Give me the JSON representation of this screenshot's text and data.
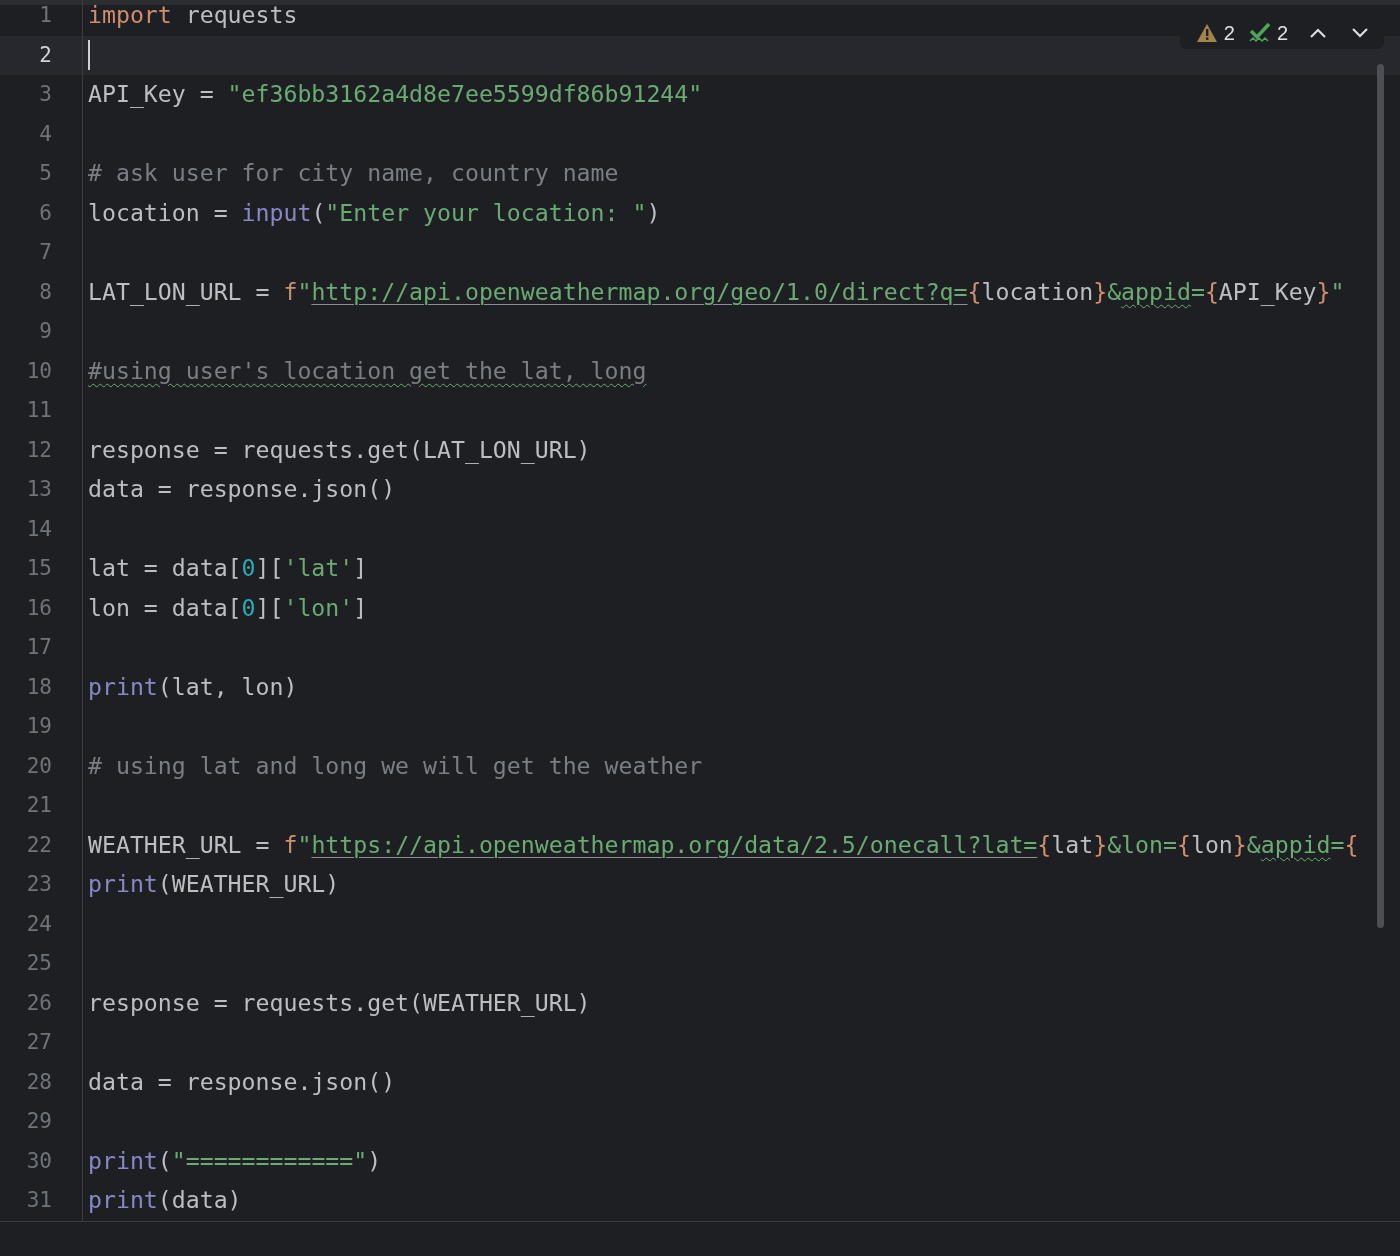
{
  "inspections": {
    "warnings": "2",
    "checks": "2"
  },
  "lines": [
    {
      "number": "1",
      "current": false,
      "tokens": [
        {
          "kind": "keyword",
          "text": "import"
        },
        {
          "kind": "plain",
          "text": " requests"
        }
      ]
    },
    {
      "number": "2",
      "current": true
    },
    {
      "number": "3",
      "current": false,
      "tokens": [
        {
          "kind": "plain",
          "text": "API_Key = "
        },
        {
          "kind": "string",
          "text": "\"ef36bb3162a4d8e7ee5599df86b91244\""
        }
      ]
    },
    {
      "number": "4",
      "current": false
    },
    {
      "number": "5",
      "current": false,
      "tokens": [
        {
          "kind": "comment",
          "text": "# ask user for city name, country name"
        }
      ]
    },
    {
      "number": "6",
      "current": false,
      "tokens": [
        {
          "kind": "plain",
          "text": "location = "
        },
        {
          "kind": "builtin",
          "text": "input"
        },
        {
          "kind": "plain",
          "text": "("
        },
        {
          "kind": "string",
          "text": "\"Enter your location: \""
        },
        {
          "kind": "plain",
          "text": ")"
        }
      ]
    },
    {
      "number": "7",
      "current": false
    },
    {
      "number": "8",
      "current": false,
      "tokens": [
        {
          "kind": "plain",
          "text": "LAT_LON_URL = "
        },
        {
          "kind": "keyword",
          "text": "f"
        },
        {
          "kind": "string",
          "text": "\""
        },
        {
          "kind": "url",
          "text": "http://api.openweathermap.org/geo/1.0/direct?q="
        },
        {
          "kind": "brace",
          "text": "{"
        },
        {
          "kind": "plain",
          "text": "location"
        },
        {
          "kind": "brace",
          "text": "}"
        },
        {
          "kind": "string",
          "text": "&"
        },
        {
          "kind": "string_flagged",
          "text": "appid"
        },
        {
          "kind": "string",
          "text": "="
        },
        {
          "kind": "brace",
          "text": "{"
        },
        {
          "kind": "plain",
          "text": "API_Key"
        },
        {
          "kind": "brace",
          "text": "}"
        },
        {
          "kind": "string",
          "text": "\""
        }
      ]
    },
    {
      "number": "9",
      "current": false
    },
    {
      "number": "10",
      "current": false,
      "tokens": [
        {
          "kind": "comment_flagged",
          "text": "#using user's location get the lat, long"
        }
      ]
    },
    {
      "number": "11",
      "current": false
    },
    {
      "number": "12",
      "current": false,
      "tokens": [
        {
          "kind": "plain",
          "text": "response = requests.get(LAT_LON_URL)"
        }
      ]
    },
    {
      "number": "13",
      "current": false,
      "tokens": [
        {
          "kind": "plain",
          "text": "data = response.json()"
        }
      ]
    },
    {
      "number": "14",
      "current": false
    },
    {
      "number": "15",
      "current": false,
      "tokens": [
        {
          "kind": "plain",
          "text": "lat = data["
        },
        {
          "kind": "number",
          "text": "0"
        },
        {
          "kind": "plain",
          "text": "]["
        },
        {
          "kind": "string",
          "text": "'lat'"
        },
        {
          "kind": "plain",
          "text": "]"
        }
      ]
    },
    {
      "number": "16",
      "current": false,
      "tokens": [
        {
          "kind": "plain",
          "text": "lon = data["
        },
        {
          "kind": "number",
          "text": "0"
        },
        {
          "kind": "plain",
          "text": "]["
        },
        {
          "kind": "string",
          "text": "'lon'"
        },
        {
          "kind": "plain",
          "text": "]"
        }
      ]
    },
    {
      "number": "17",
      "current": false
    },
    {
      "number": "18",
      "current": false,
      "tokens": [
        {
          "kind": "builtin",
          "text": "print"
        },
        {
          "kind": "plain",
          "text": "(lat, lon)"
        }
      ]
    },
    {
      "number": "19",
      "current": false
    },
    {
      "number": "20",
      "current": false,
      "tokens": [
        {
          "kind": "comment",
          "text": "# using lat and long we will get the weather"
        }
      ]
    },
    {
      "number": "21",
      "current": false
    },
    {
      "number": "22",
      "current": false,
      "tokens": [
        {
          "kind": "plain",
          "text": "WEATHER_URL = "
        },
        {
          "kind": "keyword",
          "text": "f"
        },
        {
          "kind": "string",
          "text": "\""
        },
        {
          "kind": "url",
          "text": "https://api.openweathermap.org/data/2.5/onecall?lat="
        },
        {
          "kind": "brace",
          "text": "{"
        },
        {
          "kind": "plain",
          "text": "lat"
        },
        {
          "kind": "brace",
          "text": "}"
        },
        {
          "kind": "string",
          "text": "&lon="
        },
        {
          "kind": "brace",
          "text": "{"
        },
        {
          "kind": "plain",
          "text": "lon"
        },
        {
          "kind": "brace",
          "text": "}"
        },
        {
          "kind": "string",
          "text": "&"
        },
        {
          "kind": "string_flagged",
          "text": "appid"
        },
        {
          "kind": "string",
          "text": "="
        },
        {
          "kind": "brace",
          "text": "{"
        }
      ]
    },
    {
      "number": "23",
      "current": false,
      "tokens": [
        {
          "kind": "builtin",
          "text": "print"
        },
        {
          "kind": "plain",
          "text": "(WEATHER_URL)"
        }
      ]
    },
    {
      "number": "24",
      "current": false
    },
    {
      "number": "25",
      "current": false
    },
    {
      "number": "26",
      "current": false,
      "tokens": [
        {
          "kind": "plain",
          "text": "response = requests.get(WEATHER_URL)"
        }
      ]
    },
    {
      "number": "27",
      "current": false
    },
    {
      "number": "28",
      "current": false,
      "tokens": [
        {
          "kind": "plain",
          "text": "data = response.json()"
        }
      ]
    },
    {
      "number": "29",
      "current": false
    },
    {
      "number": "30",
      "current": false,
      "tokens": [
        {
          "kind": "builtin",
          "text": "print"
        },
        {
          "kind": "plain",
          "text": "("
        },
        {
          "kind": "string",
          "text": "\"============\""
        },
        {
          "kind": "plain",
          "text": ")"
        }
      ]
    },
    {
      "number": "31",
      "current": false,
      "tokens": [
        {
          "kind": "builtin",
          "text": "print"
        },
        {
          "kind": "plain",
          "text": "(data)"
        }
      ]
    }
  ]
}
